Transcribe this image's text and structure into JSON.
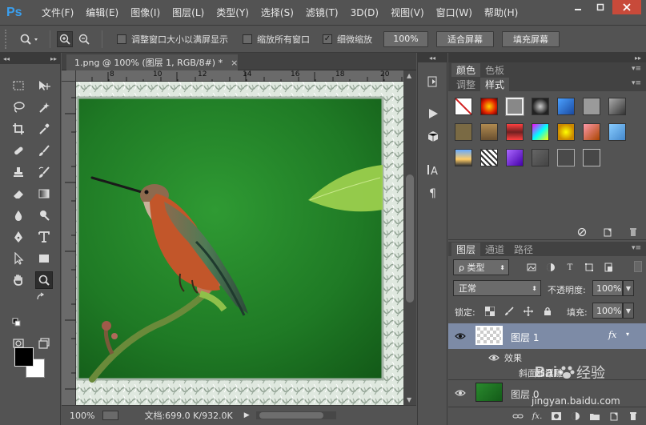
{
  "app": {
    "logo": "Ps",
    "menu": [
      "文件(F)",
      "编辑(E)",
      "图像(I)",
      "图层(L)",
      "类型(Y)",
      "选择(S)",
      "滤镜(T)",
      "3D(D)",
      "视图(V)",
      "窗口(W)",
      "帮助(H)"
    ]
  },
  "options": {
    "resize_windows_label": "调整窗口大小以满屏显示",
    "zoom_all_label": "缩放所有窗口",
    "scrubby_zoom_label": "细微缩放",
    "zoom_100_label": "100%",
    "fit_screen_label": "适合屏幕",
    "fill_screen_label": "填充屏幕",
    "resize_windows_checked": false,
    "zoom_all_checked": false,
    "scrubby_zoom_checked": true,
    "check_mark": "✓"
  },
  "document": {
    "tab_title": "1.png @ 100% (图层 1, RGB/8#) *",
    "tab_close": "×",
    "ruler_ticks": [
      "8",
      "10",
      "12",
      "14",
      "16",
      "18",
      "20"
    ],
    "zoom": "100%",
    "doc_info": "文档:699.0 K/932.0K"
  },
  "color_panel": {
    "tabs": [
      "颜色",
      "色板"
    ],
    "tabs2": [
      "调整",
      "样式"
    ],
    "active_tab2": "样式"
  },
  "layers_panel": {
    "tabs": [
      "图层",
      "通道",
      "路径"
    ],
    "filter_kind": "ρ 类型",
    "blend_mode": "正常",
    "opacity_label": "不透明度:",
    "opacity_value": "100%",
    "lock_label": "锁定:",
    "fill_label": "填充:",
    "fill_value": "100%",
    "layers": [
      {
        "name": "图层 1",
        "selected": true,
        "fx": "fx"
      },
      {
        "name": "效果",
        "effect": true
      },
      {
        "name": "斜面和浮雕",
        "effect": true
      },
      {
        "name": "图层 0",
        "selected": false
      }
    ]
  },
  "watermark": {
    "brand": "Bai",
    "site": "jingyan.baidu.com",
    "label": "经验"
  },
  "colors": {
    "bg_panel": "#535353",
    "canvas_green": "#2a8a2e",
    "selected_layer": "#7d8ba6"
  }
}
